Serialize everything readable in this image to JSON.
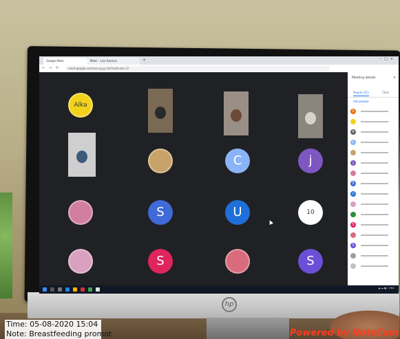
{
  "browser": {
    "tabs": [
      "Google Meet",
      "Meet – Live Session"
    ],
    "url": "meet.google.com/xxx-yyyy-zzz?authuser=0"
  },
  "meeting": {
    "tiles": [
      {
        "kind": "photo",
        "label": "Alka",
        "color": "#f2d21b"
      },
      {
        "kind": "video"
      },
      {
        "kind": "video"
      },
      {
        "kind": "video"
      },
      {
        "kind": "video"
      },
      {
        "kind": "photo",
        "color": "#c7a36a"
      },
      {
        "kind": "avatar",
        "letter": "C",
        "color": "#8ab4f8"
      },
      {
        "kind": "avatar",
        "letter": "j",
        "color": "#7e57c2"
      },
      {
        "kind": "photo",
        "color": "#d27ea0"
      },
      {
        "kind": "avatar",
        "letter": "S",
        "color": "#3f6ad8"
      },
      {
        "kind": "avatar",
        "letter": "U",
        "color": "#1e6fd9"
      },
      {
        "kind": "photo",
        "label": "10",
        "color": "#ffffff"
      },
      {
        "kind": "photo",
        "color": "#d9a0c0"
      },
      {
        "kind": "avatar",
        "letter": "S",
        "color": "#e0245e"
      },
      {
        "kind": "photo",
        "color": "#d96b7c"
      },
      {
        "kind": "avatar",
        "letter": "S",
        "color": "#6b4fd6"
      }
    ]
  },
  "panel": {
    "title": "Meeting details",
    "tab_people": "People (21)",
    "tab_chat": "Chat",
    "add_people": "Add people",
    "participants": [
      {
        "letter": "S",
        "color": "#e8710a"
      },
      {
        "letter": "",
        "color": "#f2d21b"
      },
      {
        "letter": "A",
        "color": "#5f6368"
      },
      {
        "letter": "C",
        "color": "#8ab4f8"
      },
      {
        "letter": "",
        "color": "#c7a36a"
      },
      {
        "letter": "j",
        "color": "#7e57c2"
      },
      {
        "letter": "",
        "color": "#d27ea0"
      },
      {
        "letter": "S",
        "color": "#3f6ad8"
      },
      {
        "letter": "U",
        "color": "#1e6fd9"
      },
      {
        "letter": "",
        "color": "#d9a0c0"
      },
      {
        "letter": "",
        "color": "#2f8f3a"
      },
      {
        "letter": "S",
        "color": "#e0245e"
      },
      {
        "letter": "",
        "color": "#d96b7c"
      },
      {
        "letter": "S",
        "color": "#6b4fd6"
      },
      {
        "letter": "",
        "color": "#9e9e9e"
      },
      {
        "letter": "",
        "color": "#c0c0c0"
      }
    ]
  },
  "overlay": {
    "time_line": "Time: 05-08-2020 15:04",
    "note_line": "Note: Breastfeeding promot",
    "brand": "Powered by NoteCam"
  }
}
